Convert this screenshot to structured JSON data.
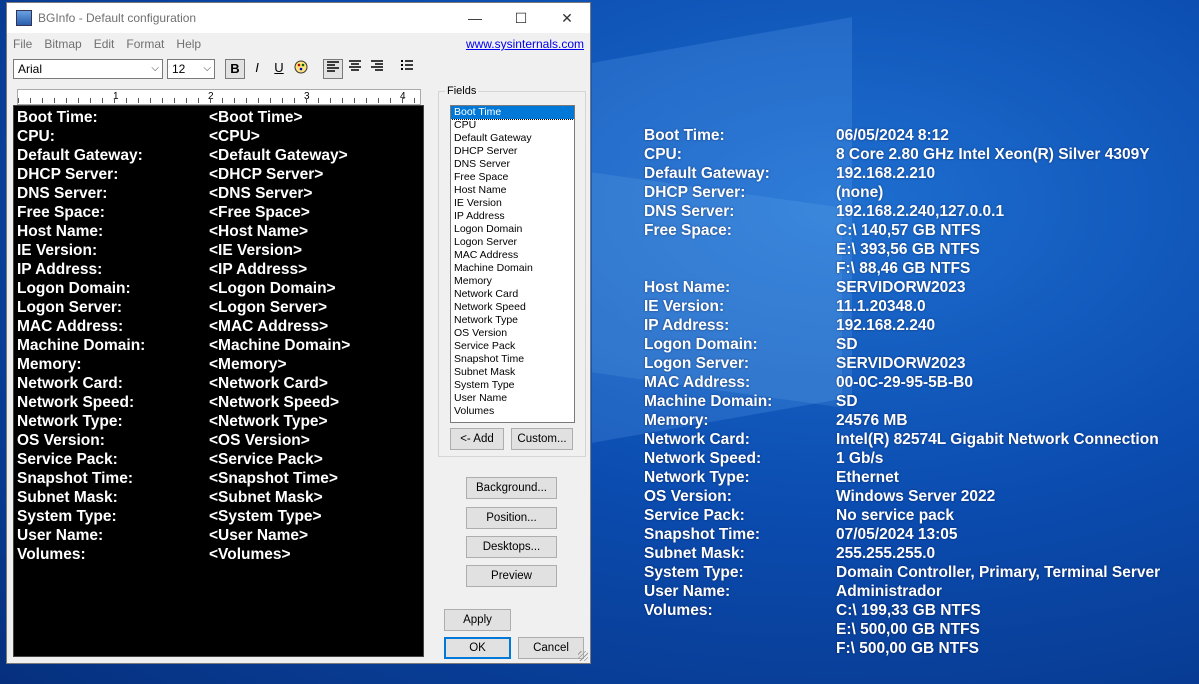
{
  "window": {
    "title": "BGInfo - Default configuration",
    "minimize": "—",
    "maximize": "☐",
    "close": "✕",
    "menus": [
      "File",
      "Bitmap",
      "Edit",
      "Format",
      "Help"
    ],
    "link": "www.sysinternals.com",
    "font_name": "Arial",
    "font_size": "12",
    "format_buttons": [
      "B",
      "I",
      "U"
    ],
    "ruler_marks": [
      "1",
      "2",
      "3",
      "4"
    ]
  },
  "editor_rows": [
    {
      "label": "Boot Time:",
      "value": "<Boot Time>"
    },
    {
      "label": "CPU:",
      "value": "<CPU>"
    },
    {
      "label": "Default Gateway:",
      "value": "<Default Gateway>"
    },
    {
      "label": "DHCP Server:",
      "value": "<DHCP Server>"
    },
    {
      "label": "DNS Server:",
      "value": "<DNS Server>"
    },
    {
      "label": "Free Space:",
      "value": "<Free Space>"
    },
    {
      "label": "Host Name:",
      "value": "<Host Name>"
    },
    {
      "label": "IE Version:",
      "value": "<IE Version>"
    },
    {
      "label": "IP Address:",
      "value": "<IP Address>"
    },
    {
      "label": "Logon Domain:",
      "value": "<Logon Domain>"
    },
    {
      "label": "Logon Server:",
      "value": "<Logon Server>"
    },
    {
      "label": "MAC Address:",
      "value": "<MAC Address>"
    },
    {
      "label": "Machine Domain:",
      "value": "<Machine Domain>"
    },
    {
      "label": "Memory:",
      "value": "<Memory>"
    },
    {
      "label": "Network Card:",
      "value": "<Network Card>"
    },
    {
      "label": "Network Speed:",
      "value": "<Network Speed>"
    },
    {
      "label": "Network Type:",
      "value": "<Network Type>"
    },
    {
      "label": "OS Version:",
      "value": "<OS Version>"
    },
    {
      "label": "Service Pack:",
      "value": "<Service Pack>"
    },
    {
      "label": "Snapshot Time:",
      "value": "<Snapshot Time>"
    },
    {
      "label": "Subnet Mask:",
      "value": "<Subnet Mask>"
    },
    {
      "label": "System Type:",
      "value": "<System Type>"
    },
    {
      "label": "User Name:",
      "value": "<User Name>"
    },
    {
      "label": "Volumes:",
      "value": "<Volumes>"
    }
  ],
  "fields": {
    "title": "Fields",
    "items": [
      "Boot Time",
      "CPU",
      "Default Gateway",
      "DHCP Server",
      "DNS Server",
      "Free Space",
      "Host Name",
      "IE Version",
      "IP Address",
      "Logon Domain",
      "Logon Server",
      "MAC Address",
      "Machine Domain",
      "Memory",
      "Network Card",
      "Network Speed",
      "Network Type",
      "OS Version",
      "Service Pack",
      "Snapshot Time",
      "Subnet Mask",
      "System Type",
      "User Name",
      "Volumes"
    ],
    "selected": "Boot Time",
    "add_label": "<- Add",
    "custom_label": "Custom..."
  },
  "buttons": {
    "background": "Background...",
    "position": "Position...",
    "desktops": "Desktops...",
    "preview": "Preview",
    "apply": "Apply",
    "ok": "OK",
    "cancel": "Cancel"
  },
  "desktop_rows": [
    {
      "label": "Boot Time:",
      "value": "06/05/2024 8:12"
    },
    {
      "label": "CPU:",
      "value": "8 Core 2.80 GHz Intel Xeon(R) Silver 4309Y"
    },
    {
      "label": "Default Gateway:",
      "value": "192.168.2.210"
    },
    {
      "label": "DHCP Server:",
      "value": "(none)"
    },
    {
      "label": "DNS Server:",
      "value": "192.168.2.240,127.0.0.1"
    },
    {
      "label": "Free Space:",
      "value": "C:\\ 140,57 GB NTFS"
    },
    {
      "label": "",
      "value": "E:\\ 393,56 GB NTFS"
    },
    {
      "label": "",
      "value": "F:\\ 88,46 GB NTFS"
    },
    {
      "label": "Host Name:",
      "value": "SERVIDORW2023"
    },
    {
      "label": "IE Version:",
      "value": "11.1.20348.0"
    },
    {
      "label": "IP Address:",
      "value": "192.168.2.240"
    },
    {
      "label": "Logon Domain:",
      "value": "SD"
    },
    {
      "label": "Logon Server:",
      "value": "SERVIDORW2023"
    },
    {
      "label": "MAC Address:",
      "value": "00-0C-29-95-5B-B0"
    },
    {
      "label": "Machine Domain:",
      "value": "SD"
    },
    {
      "label": "Memory:",
      "value": "24576 MB"
    },
    {
      "label": "Network Card:",
      "value": "Intel(R) 82574L Gigabit Network Connection"
    },
    {
      "label": "Network Speed:",
      "value": "1 Gb/s"
    },
    {
      "label": "Network Type:",
      "value": "Ethernet"
    },
    {
      "label": "OS Version:",
      "value": "Windows Server 2022"
    },
    {
      "label": "Service Pack:",
      "value": "No service pack"
    },
    {
      "label": "Snapshot Time:",
      "value": "07/05/2024 13:05"
    },
    {
      "label": "Subnet Mask:",
      "value": "255.255.255.0"
    },
    {
      "label": "System Type:",
      "value": "Domain Controller, Primary, Terminal Server"
    },
    {
      "label": "User Name:",
      "value": "Administrador"
    },
    {
      "label": "Volumes:",
      "value": "C:\\ 199,33 GB NTFS"
    },
    {
      "label": "",
      "value": "E:\\ 500,00 GB NTFS"
    },
    {
      "label": "",
      "value": "F:\\ 500,00 GB NTFS"
    }
  ]
}
